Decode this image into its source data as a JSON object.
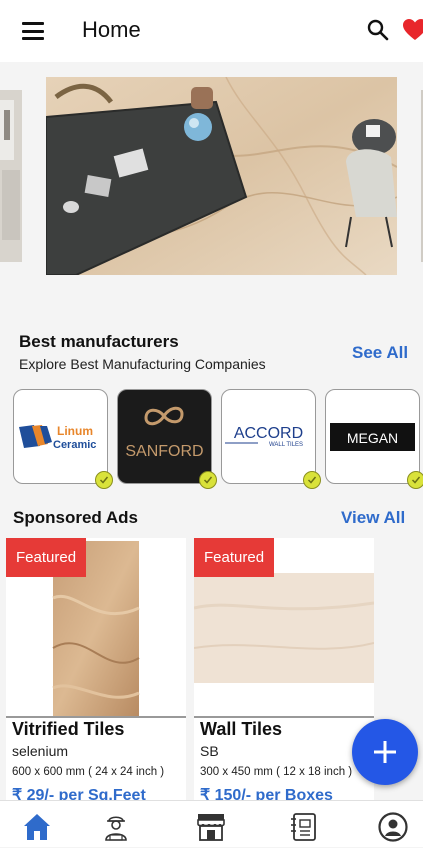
{
  "header": {
    "title": "Home"
  },
  "icons": {
    "menu": "hamburger-menu-icon",
    "search": "search-icon",
    "favorite": "heart-icon",
    "add": "plus-icon",
    "verified": "check-badge-icon"
  },
  "colors": {
    "accent": "#2f6bcb",
    "fab": "#2457e6",
    "featured_badge": "#e63a37",
    "favorite": "#e8262b",
    "verified_badge": "#d9e23a"
  },
  "manufacturers": {
    "title": "Best manufacturers",
    "subtitle": "Explore Best Manufacturing Companies",
    "see_all": "See All",
    "items": [
      {
        "logo_line1": "Linum",
        "logo_line2": "Ceramic"
      },
      {
        "logo_text": "SANFORD"
      },
      {
        "logo_text": "ACCORD",
        "logo_sub": "WALL TILES"
      },
      {
        "logo_text": "MEGAN"
      }
    ]
  },
  "sponsored": {
    "title": "Sponsored Ads",
    "view_all": "View All",
    "items": [
      {
        "badge": "Featured",
        "name": "Vitrified Tiles",
        "brand": "selenium",
        "size": "600 x 600 mm ( 24 x 24 inch )",
        "price": "₹ 29/- per Sq.Feet"
      },
      {
        "badge": "Featured",
        "name": "Wall Tiles",
        "brand": "SB",
        "size": "300 x 450 mm ( 12 x 18 inch )",
        "price": "₹ 150/- per Boxes"
      }
    ]
  },
  "bottom_nav": [
    {
      "icon": "home-icon",
      "active": true
    },
    {
      "icon": "worker-icon",
      "active": false
    },
    {
      "icon": "store-icon",
      "active": false
    },
    {
      "icon": "catalog-icon",
      "active": false
    },
    {
      "icon": "profile-icon",
      "active": false
    }
  ]
}
